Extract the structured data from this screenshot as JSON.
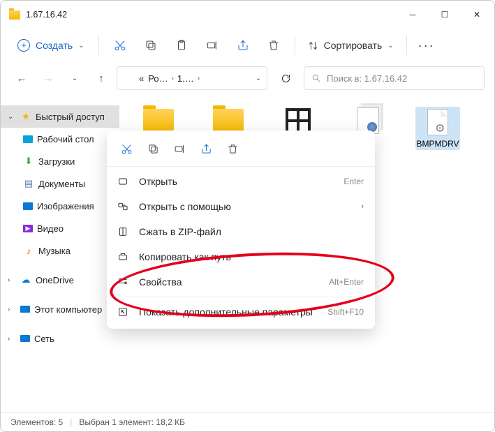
{
  "title": "1.67.16.42",
  "toolbar": {
    "new_label": "Создать",
    "sort_label": "Сортировать"
  },
  "breadcrumbs": [
    "«",
    "Ро…",
    "1.…"
  ],
  "search": {
    "placeholder": "Поиск в: 1.67.16.42"
  },
  "sidebar": {
    "quick": "Быстрый доступ",
    "items": [
      {
        "label": "Рабочий стол"
      },
      {
        "label": "Загрузки"
      },
      {
        "label": "Документы"
      },
      {
        "label": "Изображения"
      },
      {
        "label": "Видео"
      },
      {
        "label": "Музыка"
      }
    ],
    "onedrive": "OneDrive",
    "thispc": "Этот компьютер",
    "network": "Сеть"
  },
  "files": {
    "visible": {
      "name": "BMPMDRV"
    }
  },
  "ctx": {
    "open": "Открыть",
    "open_hint": "Enter",
    "openwith": "Открыть с помощью",
    "zip": "Сжать в ZIP-файл",
    "copypath": "Копировать как путь",
    "props": "Свойства",
    "props_hint": "Alt+Enter",
    "more": "Показать дополнительные параметры",
    "more_hint": "Shift+F10"
  },
  "status": {
    "count": "Элементов: 5",
    "sel": "Выбран 1 элемент: 18,2 КБ"
  }
}
